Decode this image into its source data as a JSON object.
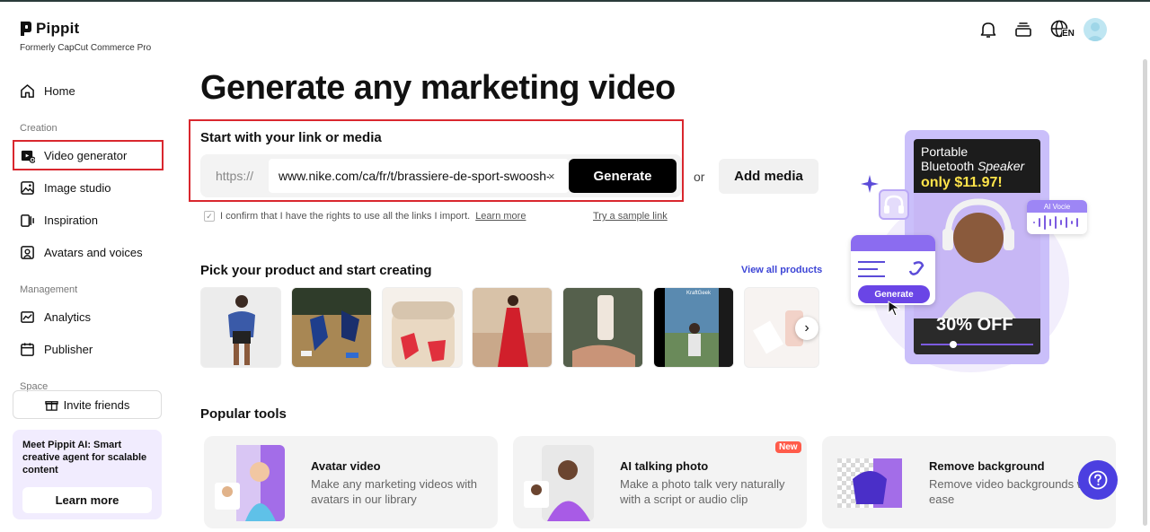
{
  "brand": {
    "name": "Pippit",
    "subtitle": "Formerly CapCut Commerce Pro"
  },
  "sidebar": {
    "home": "Home",
    "sections": {
      "creation": "Creation",
      "management": "Management",
      "space": "Space"
    },
    "items": [
      {
        "label": "Video generator",
        "icon": "video-plus-icon",
        "active": true
      },
      {
        "label": "Image studio",
        "icon": "image-plus-icon"
      },
      {
        "label": "Inspiration",
        "icon": "inspiration-icon"
      },
      {
        "label": "Avatars and voices",
        "icon": "avatar-icon"
      },
      {
        "label": "Analytics",
        "icon": "analytics-icon"
      },
      {
        "label": "Publisher",
        "icon": "calendar-icon"
      }
    ],
    "invite": "Invite friends",
    "promo": {
      "text": "Meet Pippit AI: Smart creative agent for scalable content",
      "button": "Learn more"
    }
  },
  "header": {
    "icons": [
      "bell-icon",
      "stack-icon",
      "globe-icon"
    ],
    "lang": "EN"
  },
  "main": {
    "title": "Generate any marketing video",
    "link_section": {
      "label": "Start with your link or media",
      "prefix": "https://",
      "url_value": "www.nike.com/ca/fr/t/brassiere-de-sport-swoosh-p",
      "clear": "×",
      "generate": "Generate",
      "or": "or",
      "add_media": "Add media",
      "confirm_text": "I confirm that I have the rights to use all the links I import.",
      "confirm_learn": "Learn more",
      "sample_link": "Try a sample link"
    },
    "products": {
      "title": "Pick your product and start creating",
      "view_all": "View all products",
      "thumb_label": "KraftGeek",
      "next": "›"
    },
    "tools": {
      "title": "Popular tools",
      "items": [
        {
          "name": "Avatar video",
          "desc": "Make any marketing videos with avatars in our library",
          "badge": ""
        },
        {
          "name": "AI talking photo",
          "desc": "Make a photo talk very naturally with a script or audio clip",
          "badge": "New"
        },
        {
          "name": "Remove background",
          "desc": "Remove video backgrounds with ease",
          "badge": ""
        }
      ]
    },
    "hero": {
      "line1": "Portable",
      "line2a": "Bluetooth ",
      "line2b": "Speaker",
      "price": "only $11.97!",
      "off": "30% OFF",
      "gen_pill": "Generate",
      "voice": "AI Vocie"
    }
  },
  "colors": {
    "accent": "#4b3fe0",
    "highlight": "#d9272e",
    "promo_bg": "#f1ecfe"
  }
}
